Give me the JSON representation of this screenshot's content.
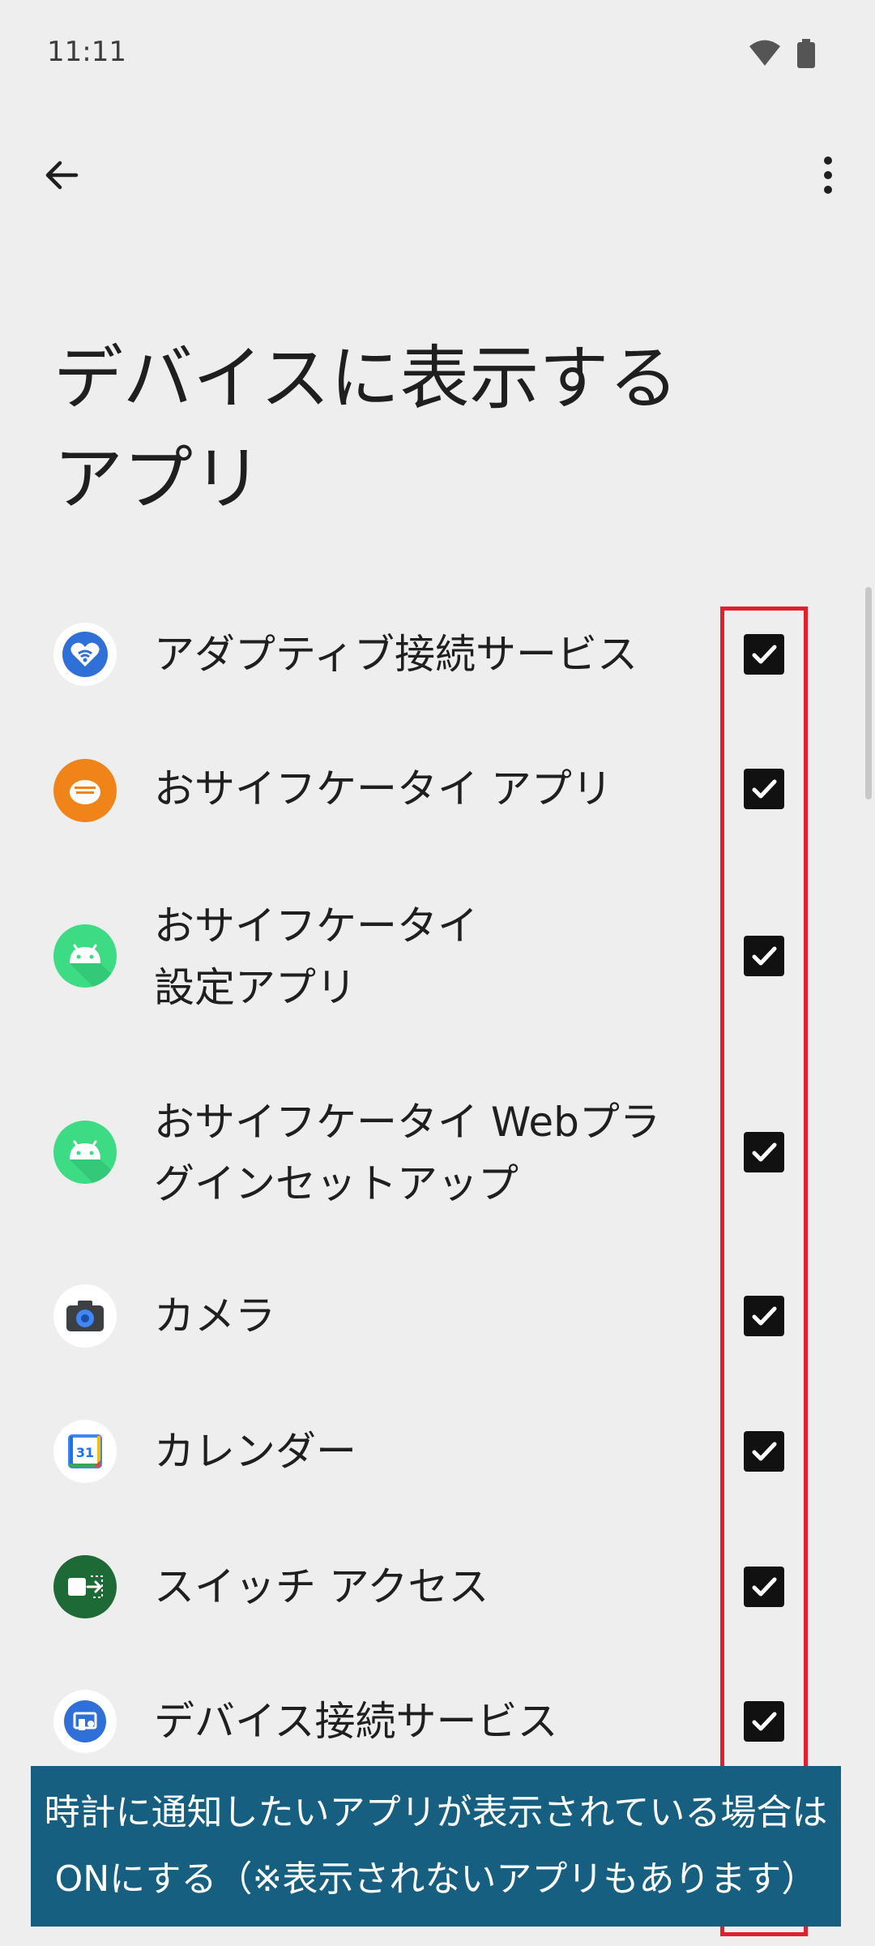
{
  "status_bar": {
    "time": "11:11"
  },
  "header": {
    "title_line1": "デバイスに表示する",
    "title_line2": "アプリ"
  },
  "apps": [
    {
      "label": "アダプティブ接続サービス",
      "icon": "adaptive-connectivity-icon",
      "checked": true
    },
    {
      "label": "おサイフケータイ アプリ",
      "icon": "osaifu-keitai-icon",
      "checked": true
    },
    {
      "label": "おサイフケータイ\n設定アプリ",
      "icon": "android-icon",
      "checked": true
    },
    {
      "label": "おサイフケータイ Webプラ\nグインセットアップ",
      "icon": "android-icon",
      "checked": true
    },
    {
      "label": "カメラ",
      "icon": "camera-icon",
      "checked": true
    },
    {
      "label": "カレンダー",
      "icon": "calendar-icon",
      "calendar_day": "31",
      "checked": true
    },
    {
      "label": "スイッチ アクセス",
      "icon": "switch-access-icon",
      "checked": true
    },
    {
      "label": "デバイス接続サービス",
      "icon": "device-connectivity-icon",
      "checked": true
    }
  ],
  "caption": {
    "line1": "時計に通知したいアプリが表示されている場合は",
    "line2": "ONにする（※表示されないアプリもあります）"
  },
  "colors": {
    "background": "#eeeeee",
    "highlight": "#e0202c",
    "caption_bg": "#175f80",
    "checkbox": "#111111"
  }
}
